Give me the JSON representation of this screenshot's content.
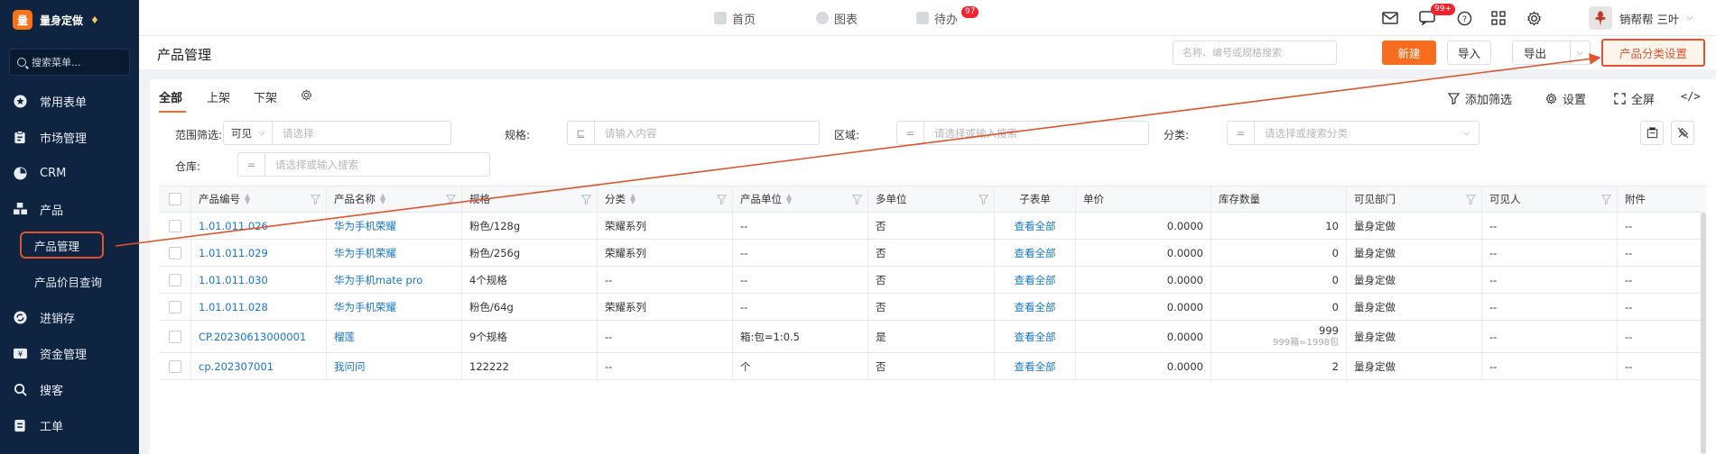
{
  "brand": {
    "logo": "量",
    "name": "量身定做",
    "badge": "♦"
  },
  "sidebar": {
    "search_placeholder": "搜索菜单...",
    "items": [
      {
        "label": "常用表单",
        "icon": "star-icon"
      },
      {
        "label": "市场管理",
        "icon": "clipboard-icon"
      },
      {
        "label": "CRM",
        "icon": "pie-icon"
      },
      {
        "label": "产品",
        "icon": "cubes-icon"
      }
    ],
    "sub_items": [
      {
        "label": "产品管理",
        "active": true
      },
      {
        "label": "产品价目查询",
        "active": false
      }
    ],
    "items2": [
      {
        "label": "进销存",
        "icon": "cycle-icon"
      },
      {
        "label": "资金管理",
        "icon": "money-icon"
      },
      {
        "label": "搜客",
        "icon": "search-icon"
      },
      {
        "label": "工单",
        "icon": "ticket-icon"
      }
    ]
  },
  "topbar": {
    "tabs": [
      {
        "label": "首页",
        "icon": "home-icon"
      },
      {
        "label": "图表",
        "icon": "chart-icon"
      },
      {
        "label": "待办",
        "icon": "todo-icon",
        "badge": "97"
      }
    ],
    "message_badge": "99+",
    "user_name": "销帮帮 三叶"
  },
  "page": {
    "title": "产品管理",
    "search_placeholder": "名称、编号或规格搜索",
    "btn_new": "新建",
    "btn_import": "导入",
    "btn_export": "导出",
    "btn_category": "产品分类设置"
  },
  "tabs": [
    "全部",
    "上架",
    "下架"
  ],
  "tools": {
    "add_filter": "添加筛选",
    "settings": "设置",
    "fullscreen": "全屏"
  },
  "filters": {
    "scope_label": "范围筛选:",
    "scope_value": "可见",
    "scope_placeholder": "请选择",
    "spec_label": "规格:",
    "spec_placeholder": "请输入内容",
    "region_label": "区域:",
    "region_placeholder": "请选择或输入搜索",
    "category_label": "分类:",
    "category_placeholder": "请选择或搜索分类",
    "warehouse_label": "仓库:",
    "warehouse_placeholder": "请选择或输入搜索"
  },
  "table": {
    "columns": [
      "产品编号",
      "产品名称",
      "规格",
      "分类",
      "产品单位",
      "多单位",
      "子表单",
      "单价",
      "库存数量",
      "可见部门",
      "可见人",
      "附件"
    ],
    "rows": [
      {
        "code": "1.01.011.026",
        "name": "华为手机荣耀",
        "spec": "粉色/128g",
        "category": "荣耀系列",
        "unit": "--",
        "multi": "否",
        "sub": "查看全部",
        "price": "0.0000",
        "stock": "10",
        "stock_sub": "",
        "dept": "量身定做",
        "person": "--",
        "attach": "--"
      },
      {
        "code": "1.01.011.029",
        "name": "华为手机荣耀",
        "spec": "粉色/256g",
        "category": "荣耀系列",
        "unit": "--",
        "multi": "否",
        "sub": "查看全部",
        "price": "0.0000",
        "stock": "0",
        "stock_sub": "",
        "dept": "量身定做",
        "person": "--",
        "attach": "--"
      },
      {
        "code": "1.01.011.030",
        "name": "华为手机mate pro",
        "spec": "4个规格",
        "category": "--",
        "unit": "--",
        "multi": "否",
        "sub": "查看全部",
        "price": "0.0000",
        "stock": "0",
        "stock_sub": "",
        "dept": "量身定做",
        "person": "--",
        "attach": "--"
      },
      {
        "code": "1.01.011.028",
        "name": "华为手机荣耀",
        "spec": "粉色/64g",
        "category": "荣耀系列",
        "unit": "--",
        "multi": "否",
        "sub": "查看全部",
        "price": "0.0000",
        "stock": "0",
        "stock_sub": "",
        "dept": "量身定做",
        "person": "--",
        "attach": "--"
      },
      {
        "code": "CP.20230613000001",
        "name": "榴莲",
        "spec": "9个规格",
        "category": "--",
        "unit": "箱:包=1:0.5",
        "multi": "是",
        "sub": "查看全部",
        "price": "0.0000",
        "stock": "999",
        "stock_sub": "999箱=1998包",
        "dept": "量身定做",
        "person": "--",
        "attach": "--"
      },
      {
        "code": "cp.202307001",
        "name": "我问问",
        "spec": "122222",
        "category": "--",
        "unit": "个",
        "multi": "否",
        "sub": "查看全部",
        "price": "0.0000",
        "stock": "2",
        "stock_sub": "",
        "dept": "量身定做",
        "person": "--",
        "attach": "--"
      }
    ]
  },
  "colors": {
    "sidebar_bg": "#0f2441",
    "accent": "#f86c1d",
    "link": "#1677d2",
    "annotation": "#e0532c"
  }
}
